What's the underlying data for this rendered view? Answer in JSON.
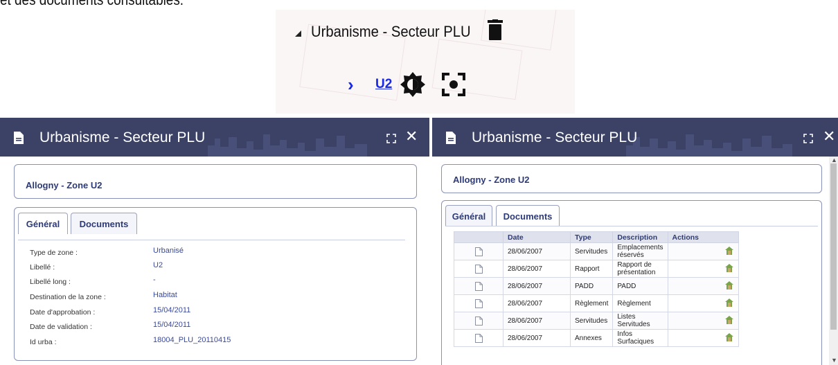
{
  "intro_text": "et des documents consultables.",
  "layer": {
    "title": "Urbanisme - Secteur PLU",
    "item_label": "U2"
  },
  "panel_left": {
    "title": "Urbanisme - Secteur PLU",
    "zone_title": "Allogny - Zone U2",
    "tabs": [
      {
        "label": "Général",
        "active": true
      },
      {
        "label": "Documents",
        "active": false
      }
    ],
    "fields": [
      {
        "key": "Type de zone :",
        "value": "Urbanisé"
      },
      {
        "key": "Libellé :",
        "value": "U2"
      },
      {
        "key": "Libellé long :",
        "value": "-"
      },
      {
        "key": "Destination de la zone :",
        "value": "Habitat"
      },
      {
        "key": "Date d'approbation :",
        "value": "15/04/2011"
      },
      {
        "key": "Date de validation :",
        "value": "15/04/2011"
      },
      {
        "key": "Id urba :",
        "value": "18004_PLU_20110415"
      }
    ]
  },
  "panel_right": {
    "title": "Urbanisme - Secteur PLU",
    "zone_title": "Allogny - Zone U2",
    "tabs": [
      {
        "label": "Général",
        "active": false
      },
      {
        "label": "Documents",
        "active": true
      }
    ],
    "table": {
      "headers": [
        "",
        "Date",
        "Type",
        "Description",
        "Actions"
      ],
      "rows": [
        {
          "date": "28/06/2007",
          "type": "Servitudes",
          "description": "Emplacements réservés"
        },
        {
          "date": "28/06/2007",
          "type": "Rapport",
          "description": "Rapport de présentation"
        },
        {
          "date": "28/06/2007",
          "type": "PADD",
          "description": "PADD"
        },
        {
          "date": "28/06/2007",
          "type": "Règlement",
          "description": "Règlement"
        },
        {
          "date": "28/06/2007",
          "type": "Servitudes",
          "description": "Listes Servitudes"
        },
        {
          "date": "28/06/2007",
          "type": "Annexes",
          "description": "Infos Surfaciques"
        }
      ]
    }
  },
  "colors": {
    "header_bg": "#3b4266",
    "link_blue": "#1a2ae0",
    "label_blue": "#2d3a78",
    "value_blue": "#3a4a9a"
  }
}
